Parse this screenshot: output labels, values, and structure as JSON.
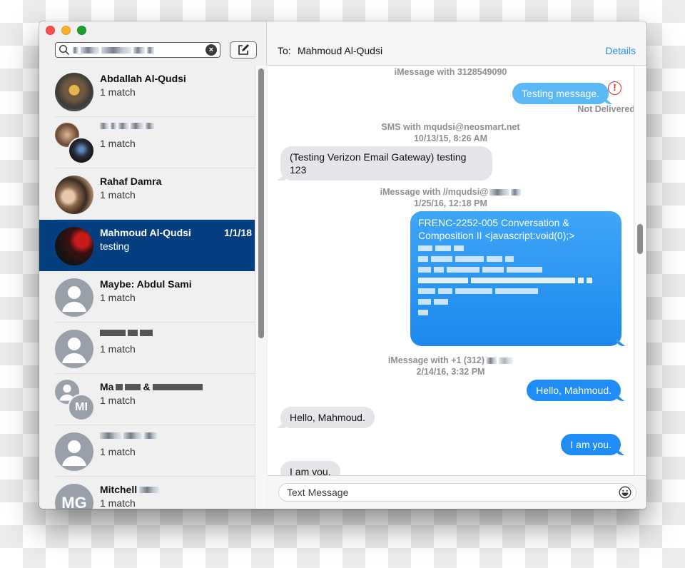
{
  "window": {
    "buttons": [
      "close",
      "minimize",
      "maximize"
    ]
  },
  "sidebar": {
    "search": {
      "value": "[redacted search text]",
      "clear_label": "×"
    },
    "compose_icon": "compose-icon",
    "conversations": [
      {
        "name": "Abdallah Al-Qudsi",
        "subtitle": "1 match",
        "date": "",
        "selected": false,
        "avatar": "photo"
      },
      {
        "name": "[redacted group name]",
        "subtitle": "1 match",
        "date": "",
        "selected": false,
        "avatar": "group-photo",
        "redacted": true
      },
      {
        "name": "Rahaf Damra",
        "subtitle": "1 match",
        "date": "",
        "selected": false,
        "avatar": "photo"
      },
      {
        "name": "Mahmoud Al-Qudsi",
        "subtitle": "testing",
        "date": "1/1/18",
        "selected": true,
        "avatar": "photo"
      },
      {
        "name": "Maybe: Abdul Sami",
        "subtitle": "1 match",
        "date": "",
        "selected": false,
        "avatar": "generic-person"
      },
      {
        "name": "[redacted name]",
        "subtitle": "1 match",
        "date": "",
        "selected": false,
        "avatar": "generic-person",
        "redacted": true
      },
      {
        "name": "Ma[redacted] & [redacted]",
        "subtitle": "1 match",
        "date": "",
        "selected": false,
        "avatar": "group-initials",
        "initials": "MI",
        "redacted": true
      },
      {
        "name": "[redacted name]",
        "subtitle": "1 match",
        "date": "",
        "selected": false,
        "avatar": "generic-person",
        "redacted": true
      },
      {
        "name": "Mitchell",
        "subtitle": "1 match",
        "date": "",
        "selected": false,
        "avatar": "initials",
        "initials": "MG",
        "redacted_suffix": true
      }
    ]
  },
  "conversation": {
    "to_label": "To:",
    "recipient": "Mahmoud Al-Qudsi",
    "details_label": "Details",
    "messages": [
      {
        "type": "meta",
        "lines": [
          "iMessage with 3128549090"
        ]
      },
      {
        "type": "out",
        "text": "Testing message.",
        "status": "Not Delivered",
        "error": true
      },
      {
        "type": "meta",
        "lines": [
          "SMS with mqudsi@neosmart.net",
          "10/13/15, 8:26 AM"
        ]
      },
      {
        "type": "in",
        "text": "(Testing Verizon Email Gateway) testing 123"
      },
      {
        "type": "meta",
        "lines": [
          "iMessage with //mqudsi@[redacted]",
          "1/25/16, 12:18 PM"
        ]
      },
      {
        "type": "out",
        "text": "FRENC-2252-005 Conversation & Composition II <javascript:void(0);>",
        "redacted_lines": 7
      },
      {
        "type": "meta",
        "lines": [
          "iMessage with +1 (312) [redacted]",
          "2/14/16, 3:32 PM"
        ]
      },
      {
        "type": "out",
        "text": "Hello, Mahmoud."
      },
      {
        "type": "in",
        "text": "Hello, Mahmoud."
      },
      {
        "type": "out",
        "text": "I am you."
      },
      {
        "type": "in",
        "text": "I am you."
      }
    ],
    "meta_texts": {
      "m1": "iMessage with 3128549090",
      "m2a": "SMS with mqudsi@neosmart.net",
      "m2b": "10/13/15, 8:26 AM",
      "m3a": "iMessage with //mqudsi@",
      "m3b": "1/25/16, 12:18 PM",
      "m4a": "iMessage with +1 (312)",
      "m4b": "2/14/16, 3:32 PM"
    },
    "bubbles": {
      "b1": "Testing message.",
      "b1_status": "Not Delivered",
      "b1_error_glyph": "!",
      "b2": "(Testing Verizon Email Gateway) testing 123",
      "b3": "FRENC-2252-005 Conversation & Composition II <javascript:void(0);>",
      "b4": "Hello, Mahmoud.",
      "b5": "Hello, Mahmoud.",
      "b6": "I am you.",
      "b7": "I am you."
    },
    "composer": {
      "placeholder": "Text Message",
      "value": "",
      "emoji_icon": "emoji-icon"
    }
  },
  "colors": {
    "selected_row": "#063f80",
    "outgoing_bubble": "#1f8df5",
    "incoming_bubble": "#e5e5ea",
    "link": "#2a8be8",
    "error": "#e0241d"
  }
}
